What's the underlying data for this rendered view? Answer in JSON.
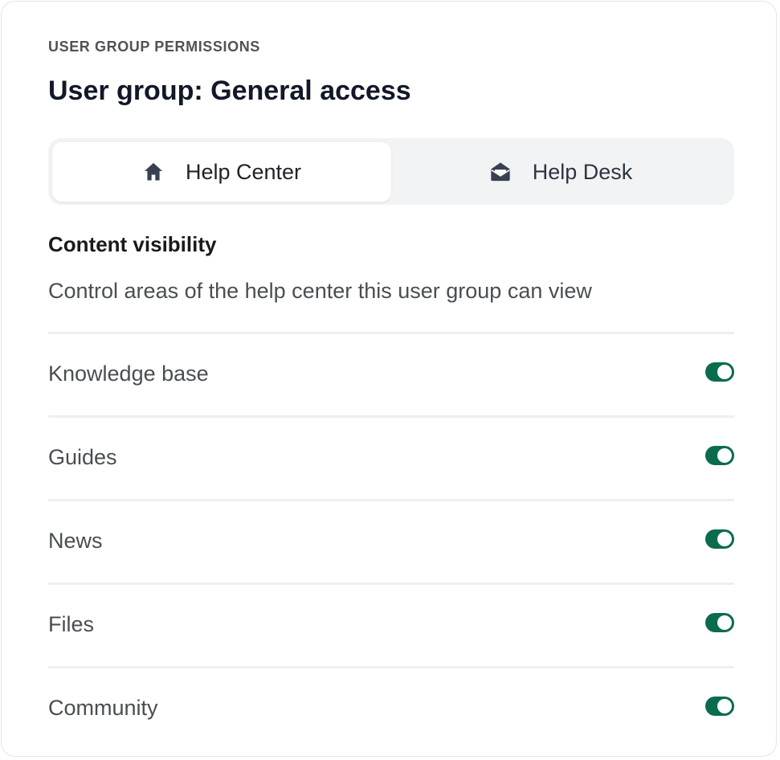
{
  "header": {
    "eyebrow": "USER GROUP PERMISSIONS",
    "title": "User group: General access"
  },
  "tabs": [
    {
      "label": "Help Center",
      "icon": "home-icon",
      "active": true
    },
    {
      "label": "Help Desk",
      "icon": "envelope-open-icon",
      "active": false
    }
  ],
  "section": {
    "title": "Content visibility",
    "description": "Control areas of the help center this user group can view"
  },
  "rows": [
    {
      "label": "Knowledge base",
      "enabled": true
    },
    {
      "label": "Guides",
      "enabled": true
    },
    {
      "label": "News",
      "enabled": true
    },
    {
      "label": "Files",
      "enabled": true
    },
    {
      "label": "Community",
      "enabled": true
    }
  ],
  "colors": {
    "toggle_on": "#0b6b4f",
    "tab_track": "#f2f3f5"
  }
}
